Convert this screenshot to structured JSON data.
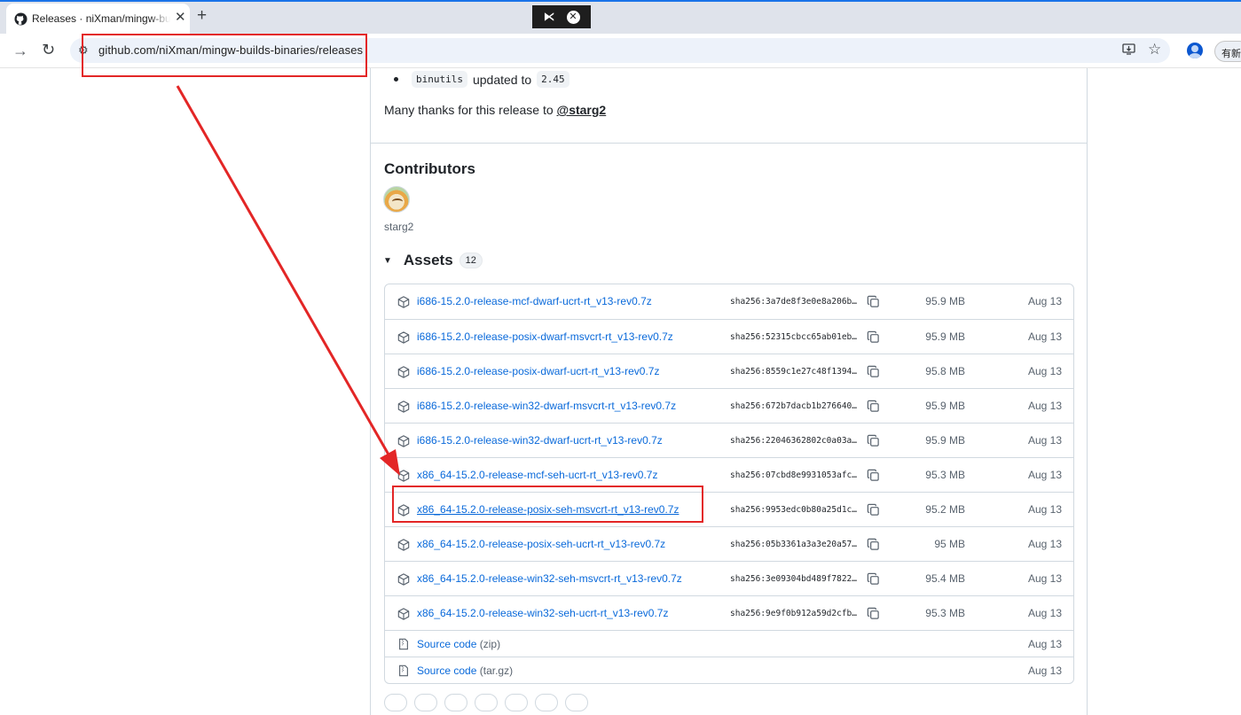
{
  "browser": {
    "tab_title": "Releases · niXman/mingw-builds-binaries",
    "tab_close": "✕",
    "new_tab": "+",
    "url": "github.com/niXman/mingw-builds-binaries/releases",
    "update_label": "有新版本"
  },
  "release": {
    "bullet": {
      "code1": "binutils",
      "text": "updated to",
      "code2": "2.45"
    },
    "thanks_prefix": "Many thanks for this release to",
    "thanks_mention": "@starg2",
    "contributors_title": "Contributors",
    "contributor_name": "starg2",
    "assets_title": "Assets",
    "assets_count": "12"
  },
  "assets": [
    {
      "name": "i686-15.2.0-release-mcf-dwarf-ucrt-rt_v13-rev0.7z",
      "sha": "sha256:3a7de8f3e0e8a206b…",
      "size": "95.9 MB",
      "date": "Aug 13"
    },
    {
      "name": "i686-15.2.0-release-posix-dwarf-msvcrt-rt_v13-rev0.7z",
      "sha": "sha256:52315cbcc65ab01eb…",
      "size": "95.9 MB",
      "date": "Aug 13"
    },
    {
      "name": "i686-15.2.0-release-posix-dwarf-ucrt-rt_v13-rev0.7z",
      "sha": "sha256:8559c1e27c48f1394…",
      "size": "95.8 MB",
      "date": "Aug 13"
    },
    {
      "name": "i686-15.2.0-release-win32-dwarf-msvcrt-rt_v13-rev0.7z",
      "sha": "sha256:672b7dacb1b276640…",
      "size": "95.9 MB",
      "date": "Aug 13"
    },
    {
      "name": "i686-15.2.0-release-win32-dwarf-ucrt-rt_v13-rev0.7z",
      "sha": "sha256:22046362802c0a03a…",
      "size": "95.9 MB",
      "date": "Aug 13"
    },
    {
      "name": "x86_64-15.2.0-release-mcf-seh-ucrt-rt_v13-rev0.7z",
      "sha": "sha256:07cbd8e9931053afc…",
      "size": "95.3 MB",
      "date": "Aug 13"
    },
    {
      "name": "x86_64-15.2.0-release-posix-seh-msvcrt-rt_v13-rev0.7z",
      "sha": "sha256:9953edc0b80a25d1c…",
      "size": "95.2 MB",
      "date": "Aug 13"
    },
    {
      "name": "x86_64-15.2.0-release-posix-seh-ucrt-rt_v13-rev0.7z",
      "sha": "sha256:05b3361a3a3e20a57…",
      "size": "95 MB",
      "date": "Aug 13"
    },
    {
      "name": "x86_64-15.2.0-release-win32-seh-msvcrt-rt_v13-rev0.7z",
      "sha": "sha256:3e09304bd489f7822…",
      "size": "95.4 MB",
      "date": "Aug 13"
    },
    {
      "name": "x86_64-15.2.0-release-win32-seh-ucrt-rt_v13-rev0.7z",
      "sha": "sha256:9e9f0b912a59d2cfb…",
      "size": "95.3 MB",
      "date": "Aug 13"
    }
  ],
  "source_code": [
    {
      "label": "Source code",
      "ext": "(zip)",
      "date": "Aug 13"
    },
    {
      "label": "Source code",
      "ext": "(tar.gz)",
      "date": "Aug 13"
    }
  ],
  "colors": {
    "link": "#0969da",
    "annotation": "#e32626",
    "chrome_tabbar": "#dfe3eb",
    "omnibox": "#edf2fa"
  }
}
